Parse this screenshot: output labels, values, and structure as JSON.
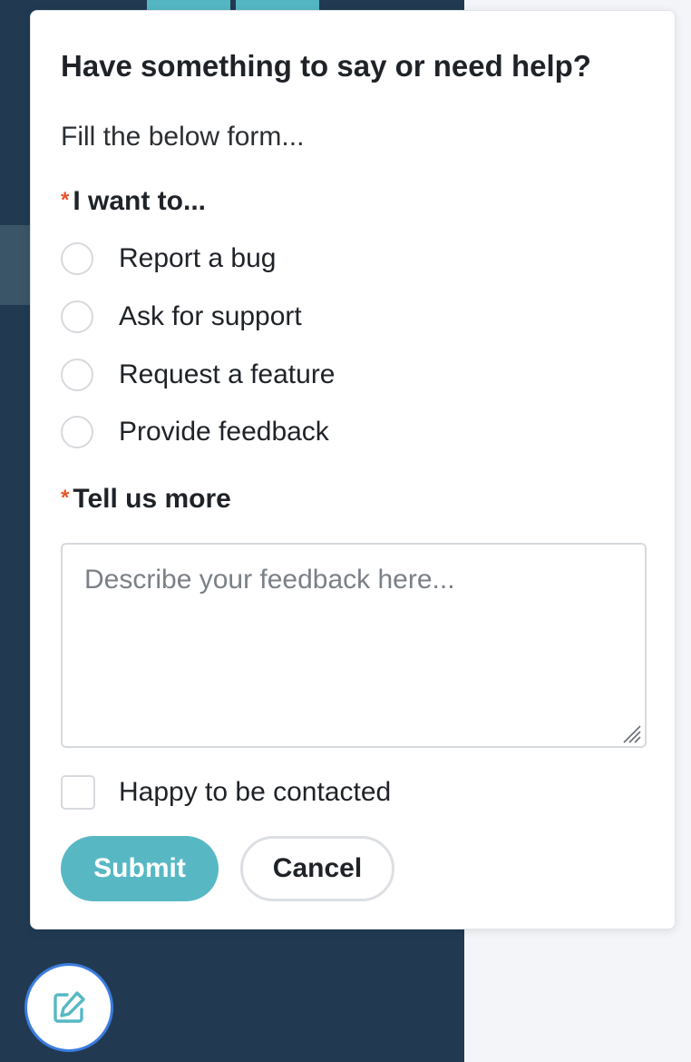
{
  "form": {
    "title": "Have something to say or need help?",
    "subtitle": "Fill the below form...",
    "intent_label": "I want to...",
    "options": [
      {
        "label": "Report a bug",
        "selected": false
      },
      {
        "label": "Ask for support",
        "selected": false
      },
      {
        "label": "Request a feature",
        "selected": false
      },
      {
        "label": "Provide feedback",
        "selected": false
      }
    ],
    "details_label": "Tell us more",
    "details_placeholder": "Describe your feedback here...",
    "details_value": "",
    "contact_label": "Happy to be contacted",
    "contact_checked": false,
    "submit_label": "Submit",
    "cancel_label": "Cancel",
    "required_marker": "*"
  },
  "colors": {
    "accent": "#57b8c4",
    "required": "#e8552c",
    "backdrop": "#213a52",
    "fab_border": "#3b7de0"
  },
  "icons": {
    "fab": "edit-feedback-icon",
    "resize": "resize-grip-icon"
  }
}
